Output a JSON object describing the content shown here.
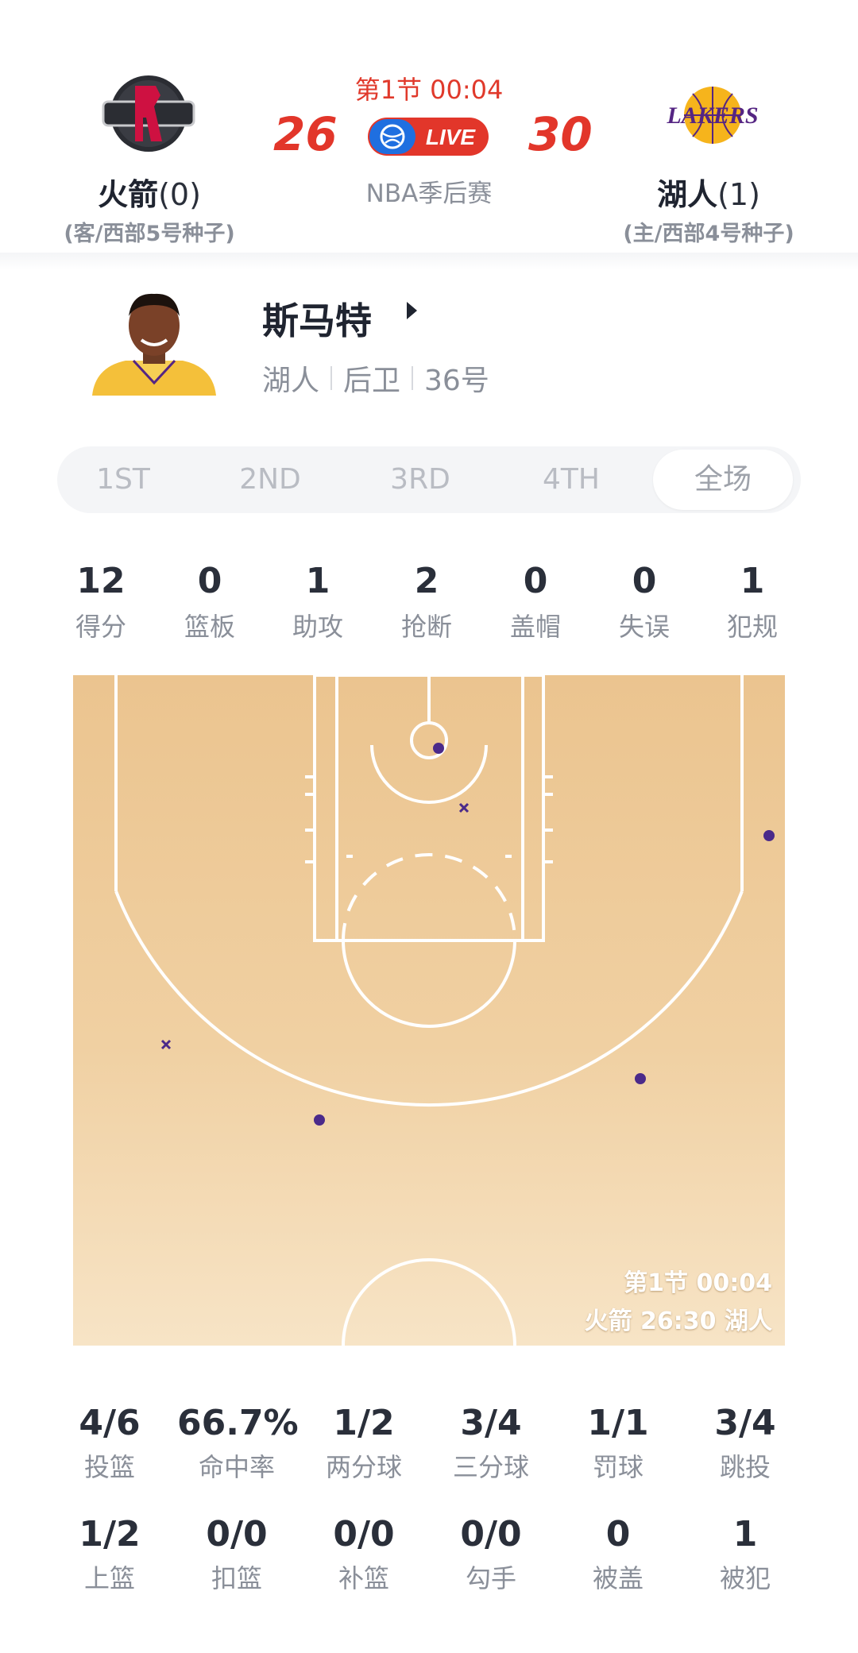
{
  "game": {
    "period_clock": "第1节 00:04",
    "league": "NBA季后赛",
    "live_label": "LIVE",
    "away": {
      "name": "火箭",
      "wins": "(0)",
      "seed": "(客/西部5号种子)",
      "score": "26",
      "logo_text": "HOUSTON ROCKETS",
      "color": "#ce1141"
    },
    "home": {
      "name": "湖人",
      "wins": "(1)",
      "seed": "(主/西部4号种子)",
      "score": "30",
      "logo_text": "LAKERS",
      "color": "#552583"
    }
  },
  "player": {
    "name": "斯马特",
    "team": "湖人",
    "position": "后卫",
    "number": "36号"
  },
  "tabs": [
    "1ST",
    "2ND",
    "3RD",
    "4TH",
    "全场"
  ],
  "active_tab": "全场",
  "box_score": [
    {
      "value": "12",
      "label": "得分"
    },
    {
      "value": "0",
      "label": "篮板"
    },
    {
      "value": "1",
      "label": "助攻"
    },
    {
      "value": "2",
      "label": "抢断"
    },
    {
      "value": "0",
      "label": "盖帽"
    },
    {
      "value": "0",
      "label": "失误"
    },
    {
      "value": "1",
      "label": "犯规"
    }
  ],
  "court": {
    "caption_line1": "第1节 00:04",
    "caption_line2": "火箭 26:30 湖人",
    "made_color": "#4b2a8a",
    "missed_color": "#4b2a8a",
    "legend": {
      "made": "dot",
      "missed": "x"
    }
  },
  "shooting": [
    {
      "value": "4/6",
      "label": "投篮"
    },
    {
      "value": "66.7%",
      "label": "命中率"
    },
    {
      "value": "1/2",
      "label": "两分球"
    },
    {
      "value": "3/4",
      "label": "三分球"
    },
    {
      "value": "1/1",
      "label": "罚球"
    },
    {
      "value": "3/4",
      "label": "跳投"
    },
    {
      "value": "1/2",
      "label": "上篮"
    },
    {
      "value": "0/0",
      "label": "扣篮"
    },
    {
      "value": "0/0",
      "label": "补篮"
    },
    {
      "value": "0/0",
      "label": "勾手"
    },
    {
      "value": "0",
      "label": "被盖"
    },
    {
      "value": "1",
      "label": "被犯"
    }
  ]
}
